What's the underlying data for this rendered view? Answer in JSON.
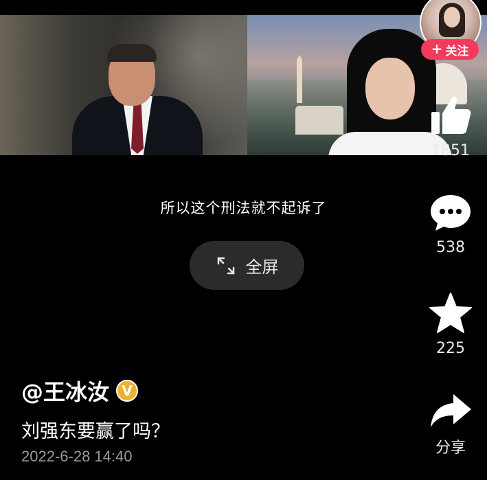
{
  "subtitle": "所以这个刑法就不起诉了",
  "fullscreen_label": "全屏",
  "follow_label": "关注",
  "actions": {
    "likes": "1851",
    "comments": "538",
    "favorites": "225",
    "share_label": "分享"
  },
  "author": "@王冰汝",
  "caption": "刘强东要赢了吗？",
  "date": "2022-6-28 14:40",
  "colors": {
    "background": "#000000",
    "follow_button": "#f23a5c",
    "verified_badge": "#f0b12c",
    "button_bg": "#2b2b2b",
    "date_text": "#9a9a9a"
  },
  "icons": {
    "like": "thumbs-up-icon",
    "comment": "speech-bubble-icon",
    "favorite": "star-icon",
    "share": "share-arrow-icon",
    "fullscreen": "expand-icon",
    "verified": "verified-badge-icon"
  }
}
